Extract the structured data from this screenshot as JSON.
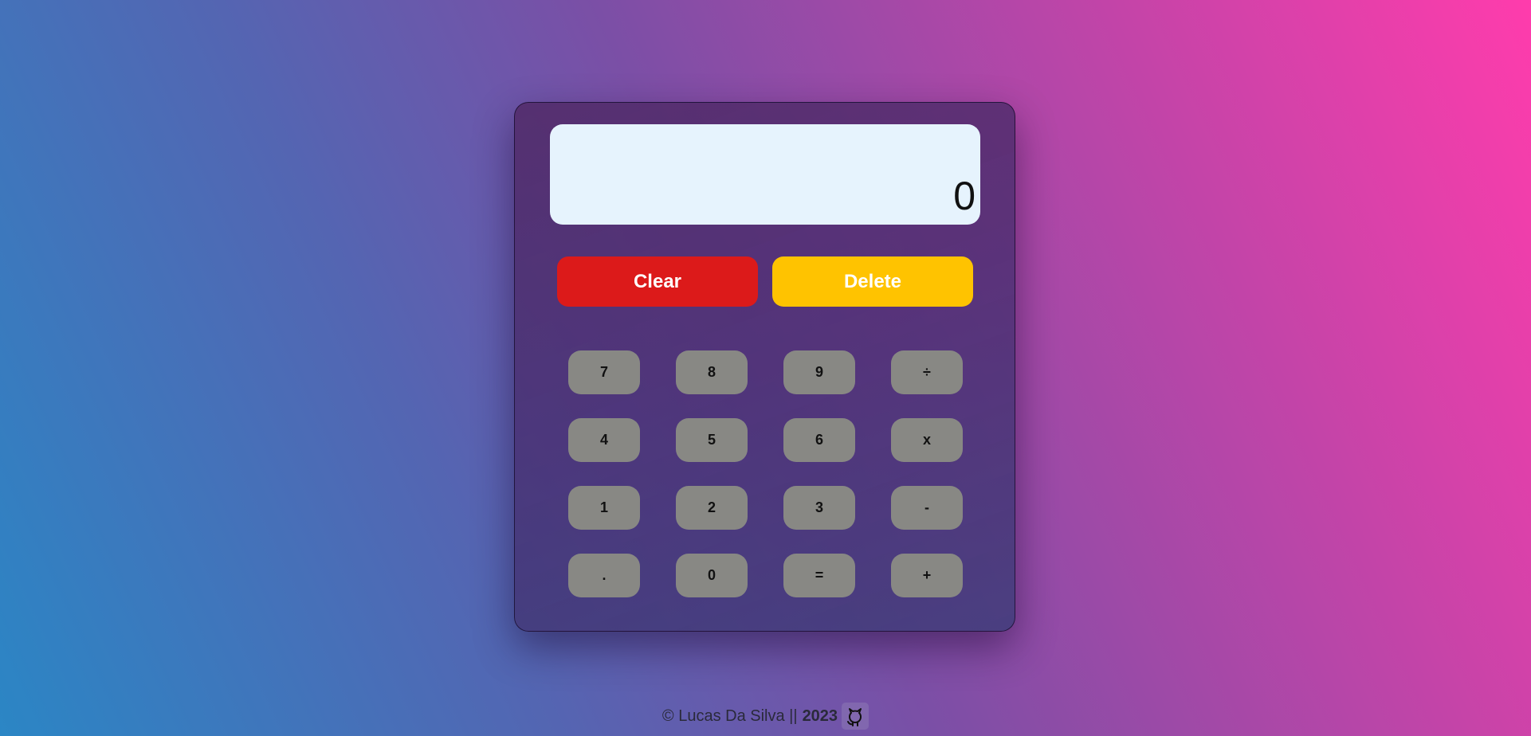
{
  "display": {
    "value": "0"
  },
  "actions": {
    "clear_label": "Clear",
    "delete_label": "Delete",
    "clear_color": "#dc1a1a",
    "delete_color": "#ffc300"
  },
  "keypad": {
    "keys": [
      "7",
      "8",
      "9",
      "÷",
      "4",
      "5",
      "6",
      "x",
      "1",
      "2",
      "3",
      "-",
      ".",
      "0",
      "=",
      "+"
    ]
  },
  "footer": {
    "credit": "© Lucas Da Silva ||",
    "year": "2023",
    "icon": "github-icon"
  },
  "colors": {
    "display_bg": "#e6f3fd",
    "key_bg": "#888884"
  }
}
